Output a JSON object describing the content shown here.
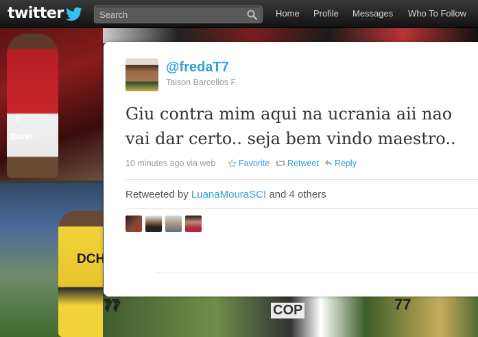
{
  "header": {
    "logo_text": "twitter",
    "search": {
      "placeholder": "Search"
    },
    "nav": [
      {
        "label": "Home"
      },
      {
        "label": "Profile"
      },
      {
        "label": "Messages"
      },
      {
        "label": "Who To Follow"
      }
    ]
  },
  "background": {
    "jersey_sponsor": "Banri",
    "jersey_number": "7",
    "jersey_text": "DCH",
    "sign_text": "COP",
    "number_77": "77"
  },
  "tweet": {
    "handle": "@fredaT7",
    "full_name": "Taison Barcellos F.",
    "text": "Giu contra mim aqui na ucrania aii nao vai dar certo.. seja bem vindo maestro..",
    "meta": "10 minutes ago via web",
    "actions": {
      "favorite": "Favorite",
      "retweet": "Retweet",
      "reply": "Reply"
    },
    "retweeted": {
      "prefix": "Retweeted by",
      "user": "LuanaMouraSCI",
      "suffix": "and 4 others"
    }
  },
  "colors": {
    "link": "#2fa0d9",
    "topbar": "#1a1a1a",
    "text": "#333333",
    "muted": "#999999"
  }
}
